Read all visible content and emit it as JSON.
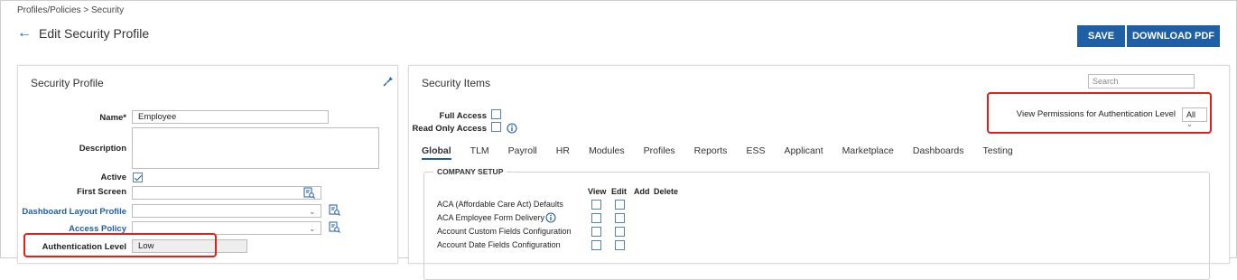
{
  "breadcrumb": "Profiles/Policies > Security",
  "header": {
    "title": "Edit Security Profile",
    "save_label": "SAVE",
    "pdf_label": "DOWNLOAD PDF"
  },
  "left_panel": {
    "title": "Security Profile",
    "name_label": "Name*",
    "name_value": "Employee",
    "description_label": "Description",
    "description_value": "",
    "active_label": "Active",
    "active_checked": true,
    "first_screen_label": "First Screen",
    "first_screen_value": "",
    "dashboard_layout_label": "Dashboard Layout Profile",
    "dashboard_layout_value": "",
    "access_policy_label": "Access Policy",
    "access_policy_value": "",
    "auth_level_label": "Authentication Level",
    "auth_level_value": "Low"
  },
  "right_panel": {
    "title": "Security Items",
    "search_placeholder": "Search",
    "full_access_label": "Full Access",
    "read_only_label": "Read Only Access",
    "view_permissions_label": "View Permissions for Authentication Level",
    "view_permissions_value": "All",
    "tabs": [
      "Global",
      "TLM",
      "Payroll",
      "HR",
      "Modules",
      "Profiles",
      "Reports",
      "ESS",
      "Applicant",
      "Marketplace",
      "Dashboards",
      "Testing"
    ],
    "active_tab": "Global",
    "section_title": "COMPANY SETUP",
    "columns": [
      "View",
      "Edit",
      "Add",
      "Delete"
    ],
    "rows": [
      "ACA (Affordable Care Act) Defaults",
      "ACA Employee Form Delivery",
      "Account Custom Fields Configuration",
      "Account Date Fields Configuration"
    ]
  },
  "colors": {
    "accent": "#1f5fa5",
    "highlight": "#e0201b"
  },
  "icons": [
    "back-arrow-icon",
    "pin-icon",
    "lookup-icon",
    "info-icon",
    "chevron-down-icon"
  ]
}
